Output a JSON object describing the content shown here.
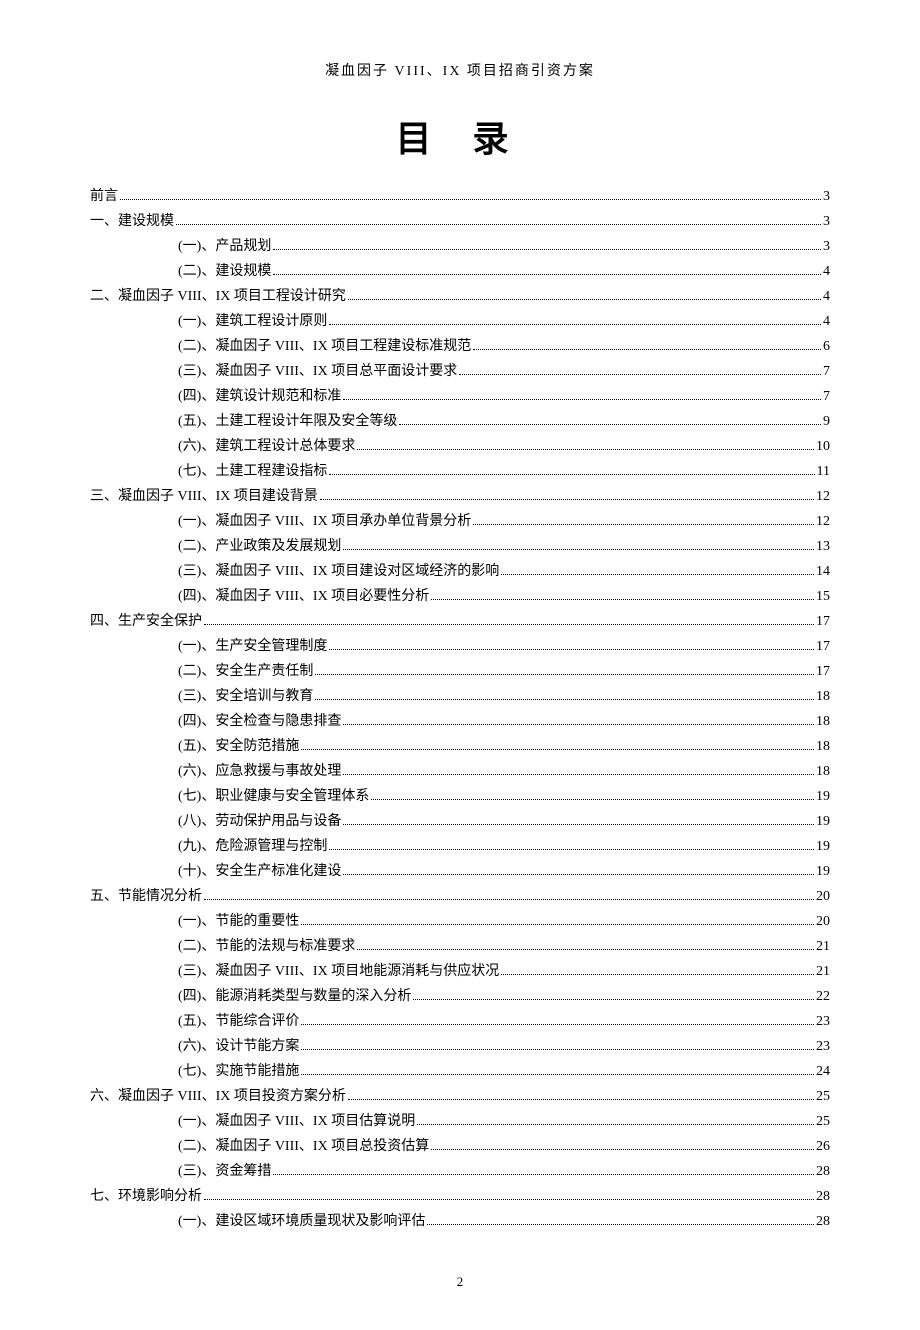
{
  "header": "凝血因子 VIII、IX 项目招商引资方案",
  "title": "目 录",
  "footer_page": "2",
  "toc": [
    {
      "level": 1,
      "label": "前言",
      "page": "3"
    },
    {
      "level": 1,
      "label": "一、建设规模",
      "page": "3"
    },
    {
      "level": 2,
      "label": "(一)、产品规划",
      "page": "3"
    },
    {
      "level": 2,
      "label": "(二)、建设规模",
      "page": "4"
    },
    {
      "level": 1,
      "label": "二、凝血因子 VIII、IX 项目工程设计研究",
      "page": "4"
    },
    {
      "level": 2,
      "label": "(一)、建筑工程设计原则",
      "page": "4"
    },
    {
      "level": 2,
      "label": "(二)、凝血因子 VIII、IX 项目工程建设标准规范",
      "page": "6"
    },
    {
      "level": 2,
      "label": "(三)、凝血因子 VIII、IX 项目总平面设计要求",
      "page": "7"
    },
    {
      "level": 2,
      "label": "(四)、建筑设计规范和标准",
      "page": "7"
    },
    {
      "level": 2,
      "label": "(五)、土建工程设计年限及安全等级",
      "page": "9"
    },
    {
      "level": 2,
      "label": "(六)、建筑工程设计总体要求",
      "page": "10"
    },
    {
      "level": 2,
      "label": "(七)、土建工程建设指标",
      "page": "11"
    },
    {
      "level": 1,
      "label": "三、凝血因子 VIII、IX 项目建设背景",
      "page": "12"
    },
    {
      "level": 2,
      "label": "(一)、凝血因子 VIII、IX 项目承办单位背景分析",
      "page": "12"
    },
    {
      "level": 2,
      "label": "(二)、产业政策及发展规划",
      "page": "13"
    },
    {
      "level": 2,
      "label": "(三)、凝血因子 VIII、IX 项目建设对区域经济的影响",
      "page": "14"
    },
    {
      "level": 2,
      "label": "(四)、凝血因子 VIII、IX 项目必要性分析",
      "page": "15"
    },
    {
      "level": 1,
      "label": "四、生产安全保护",
      "page": "17"
    },
    {
      "level": 2,
      "label": "(一)、生产安全管理制度",
      "page": "17"
    },
    {
      "level": 2,
      "label": "(二)、安全生产责任制",
      "page": "17"
    },
    {
      "level": 2,
      "label": "(三)、安全培训与教育",
      "page": "18"
    },
    {
      "level": 2,
      "label": "(四)、安全检查与隐患排查",
      "page": "18"
    },
    {
      "level": 2,
      "label": "(五)、安全防范措施",
      "page": "18"
    },
    {
      "level": 2,
      "label": "(六)、应急救援与事故处理",
      "page": "18"
    },
    {
      "level": 2,
      "label": "(七)、职业健康与安全管理体系",
      "page": "19"
    },
    {
      "level": 2,
      "label": "(八)、劳动保护用品与设备",
      "page": "19"
    },
    {
      "level": 2,
      "label": "(九)、危险源管理与控制",
      "page": "19"
    },
    {
      "level": 2,
      "label": "(十)、安全生产标准化建设",
      "page": "19"
    },
    {
      "level": 1,
      "label": "五、节能情况分析",
      "page": "20"
    },
    {
      "level": 2,
      "label": "(一)、节能的重要性",
      "page": "20"
    },
    {
      "level": 2,
      "label": "(二)、节能的法规与标准要求",
      "page": "21"
    },
    {
      "level": 2,
      "label": "(三)、凝血因子 VIII、IX 项目地能源消耗与供应状况",
      "page": "21"
    },
    {
      "level": 2,
      "label": "(四)、能源消耗类型与数量的深入分析",
      "page": "22"
    },
    {
      "level": 2,
      "label": "(五)、节能综合评价",
      "page": "23"
    },
    {
      "level": 2,
      "label": "(六)、设计节能方案",
      "page": "23"
    },
    {
      "level": 2,
      "label": "(七)、实施节能措施",
      "page": "24"
    },
    {
      "level": 1,
      "label": "六、凝血因子 VIII、IX 项目投资方案分析",
      "page": "25"
    },
    {
      "level": 2,
      "label": "(一)、凝血因子 VIII、IX 项目估算说明",
      "page": "25"
    },
    {
      "level": 2,
      "label": "(二)、凝血因子 VIII、IX 项目总投资估算",
      "page": "26"
    },
    {
      "level": 2,
      "label": "(三)、资金筹措",
      "page": "28"
    },
    {
      "level": 1,
      "label": "七、环境影响分析",
      "page": "28"
    },
    {
      "level": 2,
      "label": "(一)、建设区域环境质量现状及影响评估",
      "page": "28"
    }
  ]
}
